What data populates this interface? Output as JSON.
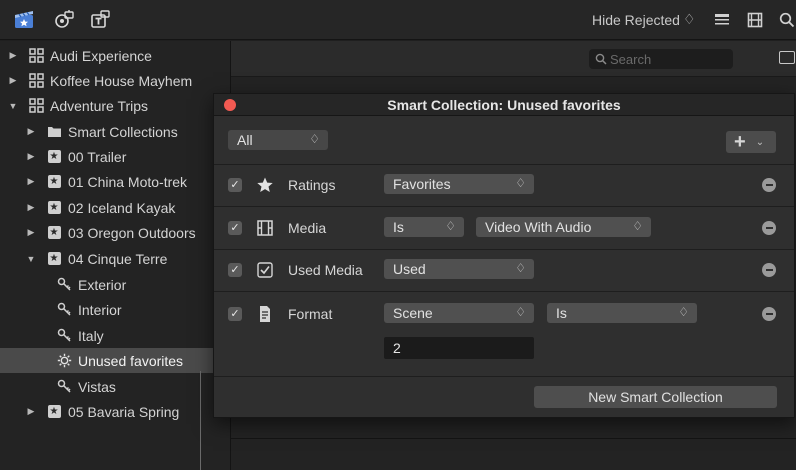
{
  "toolbar": {
    "library_icon": "clapper-star-icon",
    "photos_icon": "photos-audio-icon",
    "titles_icon": "titles-icon",
    "hide_rejected_label": "Hide Rejected",
    "hide_rejected_arrows": "♢",
    "right_icons": [
      "list-view-icon",
      "filmstrip-icon",
      "search-icon"
    ]
  },
  "sidebar": {
    "items": [
      {
        "label": "Audi Experience",
        "disclosure": "▶",
        "icon": "library-icon"
      },
      {
        "label": "Koffee House Mayhem",
        "disclosure": "▶",
        "icon": "library-icon"
      },
      {
        "label": "Adventure Trips",
        "disclosure": "▼",
        "icon": "library-icon"
      },
      {
        "label": "Smart Collections",
        "disclosure": "▶",
        "icon": "folder-icon"
      },
      {
        "label": "00 Trailer",
        "disclosure": "▶",
        "icon": "event-star-icon"
      },
      {
        "label": "01 China Moto-trek",
        "disclosure": "▶",
        "icon": "event-star-icon"
      },
      {
        "label": "02 Iceland Kayak",
        "disclosure": "▶",
        "icon": "event-star-icon"
      },
      {
        "label": "03 Oregon Outdoors",
        "disclosure": "▶",
        "icon": "event-star-icon"
      },
      {
        "label": "04 Cinque Terre",
        "disclosure": "▼",
        "icon": "event-star-icon"
      },
      {
        "label": "Exterior",
        "disclosure": "",
        "icon": "keyword-icon"
      },
      {
        "label": "Interior",
        "disclosure": "",
        "icon": "keyword-icon"
      },
      {
        "label": "Italy",
        "disclosure": "",
        "icon": "keyword-icon"
      },
      {
        "label": "Unused favorites",
        "disclosure": "",
        "icon": "smart-collection-gear-icon",
        "selected": true
      },
      {
        "label": "Vistas",
        "disclosure": "",
        "icon": "keyword-icon"
      },
      {
        "label": "05 Bavaria Spring",
        "disclosure": "▶",
        "icon": "event-star-icon"
      }
    ]
  },
  "browser": {
    "search_placeholder": "Search"
  },
  "dialog": {
    "title": "Smart Collection: Unused favorites",
    "match": {
      "value": "All",
      "arrows": "♢"
    },
    "add_button": {
      "plus": "+",
      "chevron": "⌄"
    },
    "rules": [
      {
        "checked": true,
        "check_glyph": "✓",
        "icon": "star-icon",
        "label": "Ratings",
        "popups": [
          {
            "value": "Favorites",
            "arrows": "♢"
          }
        ]
      },
      {
        "checked": true,
        "check_glyph": "✓",
        "icon": "film-icon",
        "label": "Media",
        "popups": [
          {
            "value": "Is",
            "arrows": "♢"
          },
          {
            "value": "Video With Audio",
            "arrows": "♢"
          }
        ]
      },
      {
        "checked": true,
        "check_glyph": "✓",
        "icon": "checkbox-icon",
        "label": "Used Media",
        "popups": [
          {
            "value": "Used",
            "arrows": "♢"
          }
        ]
      },
      {
        "checked": true,
        "check_glyph": "✓",
        "icon": "document-icon",
        "label": "Format",
        "popups": [
          {
            "value": "Scene",
            "arrows": "♢"
          },
          {
            "value": "Is",
            "arrows": "♢"
          }
        ],
        "number_value": "2"
      }
    ],
    "new_button_label": "New Smart Collection"
  },
  "colors": {
    "close_dot": "#f25a52",
    "selected_row": "#4a4a4a",
    "dialog_bg": "#2f2f2f"
  }
}
